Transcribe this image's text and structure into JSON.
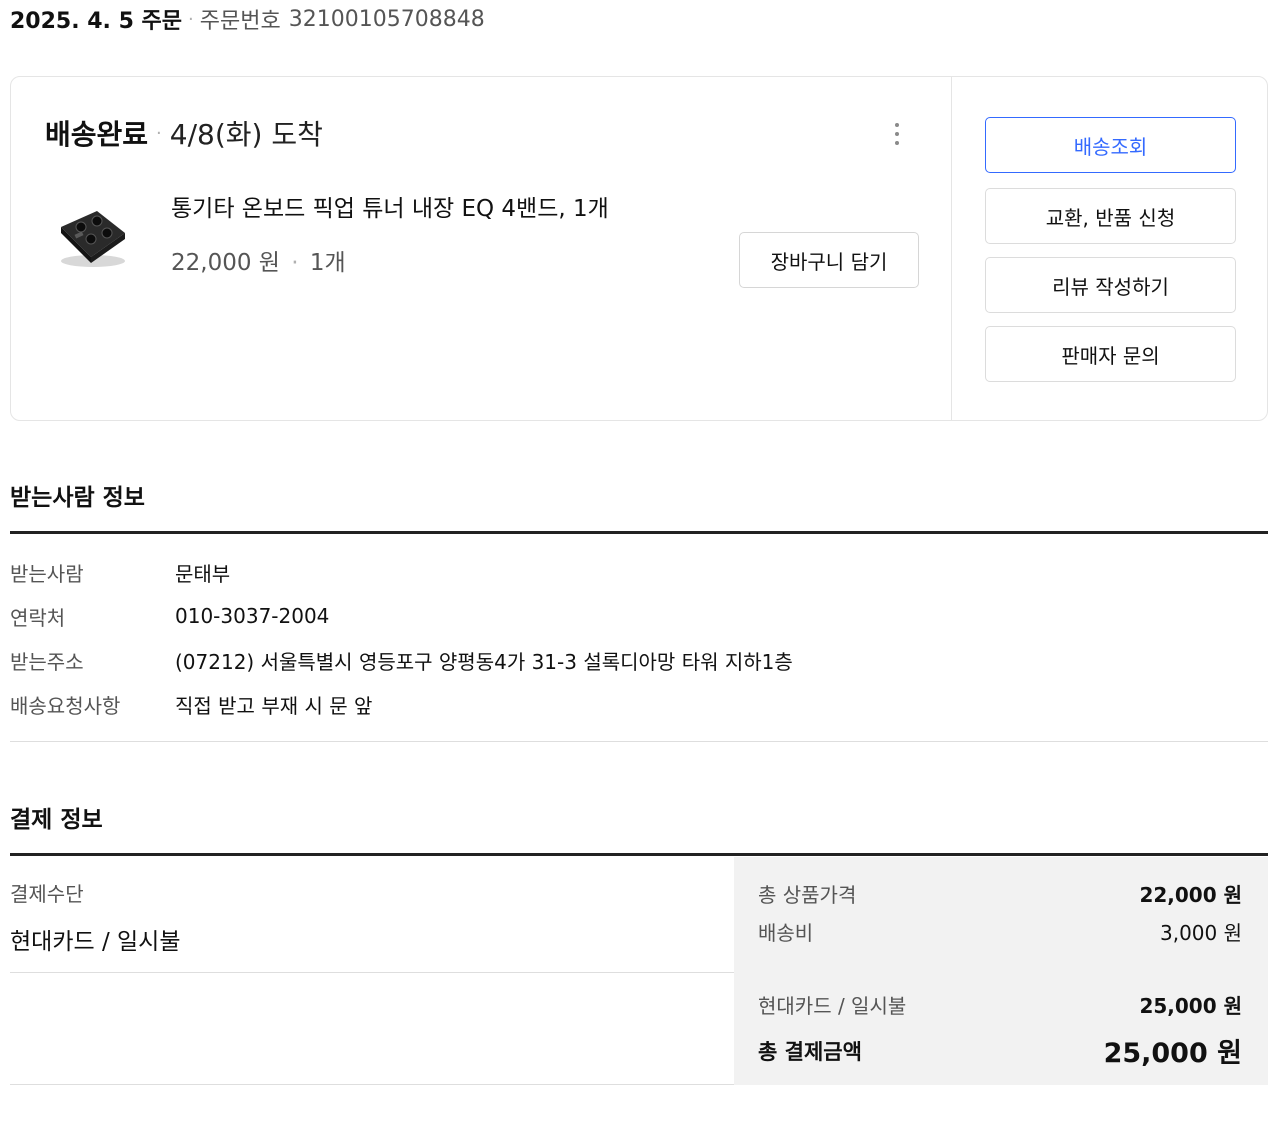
{
  "order": {
    "date": "2025. 4. 5 주문",
    "number_label": "주문번호",
    "number": "32100105708848"
  },
  "shipment": {
    "status": "배송완료",
    "arrival": "4/8(화) 도착",
    "product": {
      "name": "통기타 온보드 픽업 튜너 내장 EQ 4밴드, 1개",
      "price": "22,000 원",
      "quantity": "1개",
      "image_icon": "guitar-pickup-product-image"
    },
    "cart_button": "장바구니 담기",
    "more_icon": "kebab-menu-icon",
    "actions": {
      "track": "배송조회",
      "exchange": "교환, 반품 신청",
      "review": "리뷰 작성하기",
      "inquiry": "판매자 문의"
    },
    "accent_color": "#346aff"
  },
  "recipient": {
    "title": "받는사람 정보",
    "rows": [
      {
        "label": "받는사람",
        "value": "문태부"
      },
      {
        "label": "연락처",
        "value": "010-3037-2004"
      },
      {
        "label": "받는주소",
        "value": "(07212) 서울특별시 영등포구 양평동4가 31-3 설록디아망 타워 지하1층"
      },
      {
        "label": "배송요청사항",
        "value": "직접 받고 부재 시 문 앞"
      }
    ]
  },
  "payment": {
    "title": "결제 정보",
    "method_label": "결제수단",
    "method": "현대카드 / 일시불",
    "items_label": "총 상품가격",
    "items_value": "22,000 원",
    "shipping_label": "배송비",
    "shipping_value": "3,000 원",
    "card_label": "현대카드 / 일시불",
    "card_value": "25,000 원",
    "total_label": "총 결제금액",
    "total_value": "25,000 원"
  }
}
